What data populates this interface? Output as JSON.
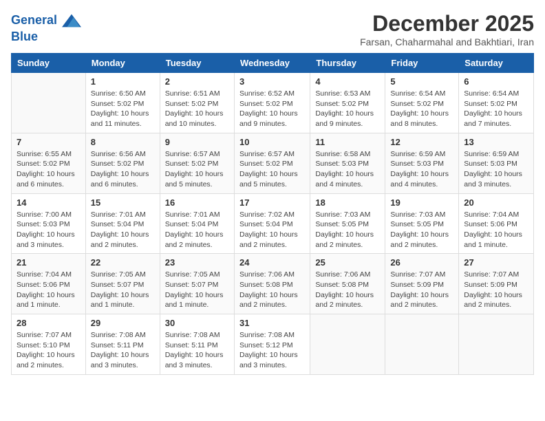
{
  "logo": {
    "line1": "General",
    "line2": "Blue"
  },
  "title": "December 2025",
  "subtitle": "Farsan, Chaharmahal and Bakhtiari, Iran",
  "days_of_week": [
    "Sunday",
    "Monday",
    "Tuesday",
    "Wednesday",
    "Thursday",
    "Friday",
    "Saturday"
  ],
  "weeks": [
    [
      {
        "day": "",
        "info": ""
      },
      {
        "day": "1",
        "info": "Sunrise: 6:50 AM\nSunset: 5:02 PM\nDaylight: 10 hours\nand 11 minutes."
      },
      {
        "day": "2",
        "info": "Sunrise: 6:51 AM\nSunset: 5:02 PM\nDaylight: 10 hours\nand 10 minutes."
      },
      {
        "day": "3",
        "info": "Sunrise: 6:52 AM\nSunset: 5:02 PM\nDaylight: 10 hours\nand 9 minutes."
      },
      {
        "day": "4",
        "info": "Sunrise: 6:53 AM\nSunset: 5:02 PM\nDaylight: 10 hours\nand 9 minutes."
      },
      {
        "day": "5",
        "info": "Sunrise: 6:54 AM\nSunset: 5:02 PM\nDaylight: 10 hours\nand 8 minutes."
      },
      {
        "day": "6",
        "info": "Sunrise: 6:54 AM\nSunset: 5:02 PM\nDaylight: 10 hours\nand 7 minutes."
      }
    ],
    [
      {
        "day": "7",
        "info": "Sunrise: 6:55 AM\nSunset: 5:02 PM\nDaylight: 10 hours\nand 6 minutes."
      },
      {
        "day": "8",
        "info": "Sunrise: 6:56 AM\nSunset: 5:02 PM\nDaylight: 10 hours\nand 6 minutes."
      },
      {
        "day": "9",
        "info": "Sunrise: 6:57 AM\nSunset: 5:02 PM\nDaylight: 10 hours\nand 5 minutes."
      },
      {
        "day": "10",
        "info": "Sunrise: 6:57 AM\nSunset: 5:02 PM\nDaylight: 10 hours\nand 5 minutes."
      },
      {
        "day": "11",
        "info": "Sunrise: 6:58 AM\nSunset: 5:03 PM\nDaylight: 10 hours\nand 4 minutes."
      },
      {
        "day": "12",
        "info": "Sunrise: 6:59 AM\nSunset: 5:03 PM\nDaylight: 10 hours\nand 4 minutes."
      },
      {
        "day": "13",
        "info": "Sunrise: 6:59 AM\nSunset: 5:03 PM\nDaylight: 10 hours\nand 3 minutes."
      }
    ],
    [
      {
        "day": "14",
        "info": "Sunrise: 7:00 AM\nSunset: 5:03 PM\nDaylight: 10 hours\nand 3 minutes."
      },
      {
        "day": "15",
        "info": "Sunrise: 7:01 AM\nSunset: 5:04 PM\nDaylight: 10 hours\nand 2 minutes."
      },
      {
        "day": "16",
        "info": "Sunrise: 7:01 AM\nSunset: 5:04 PM\nDaylight: 10 hours\nand 2 minutes."
      },
      {
        "day": "17",
        "info": "Sunrise: 7:02 AM\nSunset: 5:04 PM\nDaylight: 10 hours\nand 2 minutes."
      },
      {
        "day": "18",
        "info": "Sunrise: 7:03 AM\nSunset: 5:05 PM\nDaylight: 10 hours\nand 2 minutes."
      },
      {
        "day": "19",
        "info": "Sunrise: 7:03 AM\nSunset: 5:05 PM\nDaylight: 10 hours\nand 2 minutes."
      },
      {
        "day": "20",
        "info": "Sunrise: 7:04 AM\nSunset: 5:06 PM\nDaylight: 10 hours\nand 1 minute."
      }
    ],
    [
      {
        "day": "21",
        "info": "Sunrise: 7:04 AM\nSunset: 5:06 PM\nDaylight: 10 hours\nand 1 minute."
      },
      {
        "day": "22",
        "info": "Sunrise: 7:05 AM\nSunset: 5:07 PM\nDaylight: 10 hours\nand 1 minute."
      },
      {
        "day": "23",
        "info": "Sunrise: 7:05 AM\nSunset: 5:07 PM\nDaylight: 10 hours\nand 1 minute."
      },
      {
        "day": "24",
        "info": "Sunrise: 7:06 AM\nSunset: 5:08 PM\nDaylight: 10 hours\nand 2 minutes."
      },
      {
        "day": "25",
        "info": "Sunrise: 7:06 AM\nSunset: 5:08 PM\nDaylight: 10 hours\nand 2 minutes."
      },
      {
        "day": "26",
        "info": "Sunrise: 7:07 AM\nSunset: 5:09 PM\nDaylight: 10 hours\nand 2 minutes."
      },
      {
        "day": "27",
        "info": "Sunrise: 7:07 AM\nSunset: 5:09 PM\nDaylight: 10 hours\nand 2 minutes."
      }
    ],
    [
      {
        "day": "28",
        "info": "Sunrise: 7:07 AM\nSunset: 5:10 PM\nDaylight: 10 hours\nand 2 minutes."
      },
      {
        "day": "29",
        "info": "Sunrise: 7:08 AM\nSunset: 5:11 PM\nDaylight: 10 hours\nand 3 minutes."
      },
      {
        "day": "30",
        "info": "Sunrise: 7:08 AM\nSunset: 5:11 PM\nDaylight: 10 hours\nand 3 minutes."
      },
      {
        "day": "31",
        "info": "Sunrise: 7:08 AM\nSunset: 5:12 PM\nDaylight: 10 hours\nand 3 minutes."
      },
      {
        "day": "",
        "info": ""
      },
      {
        "day": "",
        "info": ""
      },
      {
        "day": "",
        "info": ""
      }
    ]
  ]
}
